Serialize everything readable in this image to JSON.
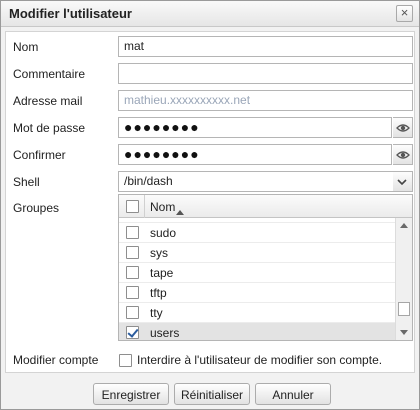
{
  "dialog": {
    "title": "Modifier l'utilisateur",
    "close_glyph": "×"
  },
  "form": {
    "nom": {
      "label": "Nom",
      "value": "mat"
    },
    "commentaire": {
      "label": "Commentaire",
      "value": ""
    },
    "email": {
      "label": "Adresse mail",
      "value": "mathieu.xxxxxxxxxx.net"
    },
    "password": {
      "label": "Mot de passe",
      "value": "●●●●●●●●",
      "icon": "eye-icon"
    },
    "confirm": {
      "label": "Confirmer",
      "value": "●●●●●●●●",
      "icon": "eye-icon"
    },
    "shell": {
      "label": "Shell",
      "value": "/bin/dash",
      "icon": "chevron-down-icon"
    },
    "groupes": {
      "label": "Groupes"
    }
  },
  "groups_grid": {
    "column_title": "Nom",
    "sort_icon": "sort-ascending-icon",
    "rows": [
      {
        "label": "sudo",
        "checked": false
      },
      {
        "label": "sys",
        "checked": false
      },
      {
        "label": "tape",
        "checked": false
      },
      {
        "label": "tftp",
        "checked": false
      },
      {
        "label": "tty",
        "checked": false
      },
      {
        "label": "users",
        "checked": true
      }
    ]
  },
  "modify_account": {
    "label": "Modifier compte",
    "checkbox_text": "Interdire à l'utilisateur de modifier son compte.",
    "checked": false
  },
  "buttons": {
    "save": "Enregistrer",
    "reset": "Réinitialiser",
    "cancel": "Annuler"
  }
}
